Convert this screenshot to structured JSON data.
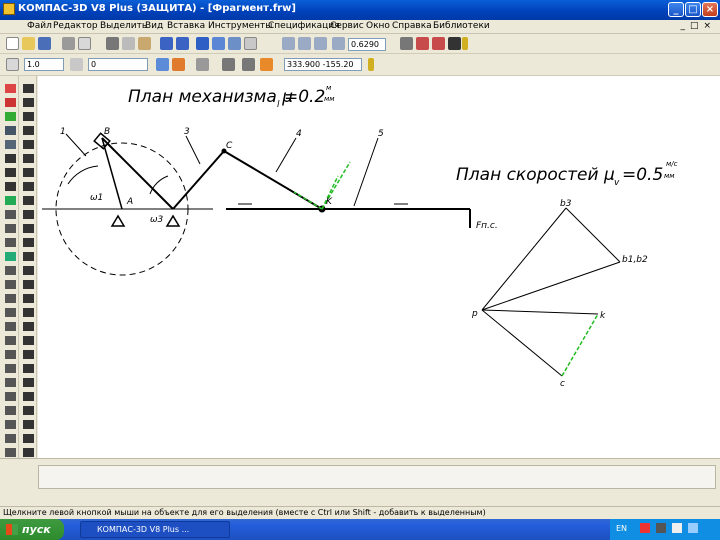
{
  "window": {
    "title": "КОМПАС-3D V8 Plus (ЗАЩИТА) - [Фрагмент.frw]"
  },
  "menu": {
    "items": [
      "Файл",
      "Редактор",
      "Выделить",
      "Вид",
      "Вставка",
      "Инструменты",
      "Спецификация",
      "Сервис",
      "Окно",
      "Справка",
      "Библиотеки"
    ]
  },
  "toolbar": {
    "scale_value": "0.6290",
    "style_value": "1.0",
    "layer_value": "0",
    "coords_value": "333.900   -155.20"
  },
  "drawing": {
    "mechanism_title": "План механизма  μ",
    "mechanism_sub": "l",
    "mechanism_val": "=0.2",
    "mechanism_unit_top": "м",
    "mechanism_unit_bottom": "мм",
    "velocity_title": "План скоростей  μ",
    "velocity_sub": "v",
    "velocity_val": "=0.5",
    "velocity_unit_top": "м/с",
    "velocity_unit_bottom": "мм",
    "mechanism_labels": {
      "link1": "1",
      "link3": "3",
      "link4": "4",
      "link5": "5",
      "pointB": "B",
      "pointC": "C",
      "pointA": "A",
      "pointK": "K",
      "w1": "ω1",
      "w3": "ω3",
      "force": "Fп.с."
    },
    "velocity_labels": {
      "pole": "p",
      "b3": "b3",
      "b1b2": "b1,b2",
      "k": "k",
      "c": "c"
    }
  },
  "status": {
    "hint": "Щелкните левой кнопкой мыши на объекте для его выделения (вместе с Ctrl или Shift - добавить к выделенным)"
  },
  "taskbar": {
    "start_label": "пуск",
    "app_item": "КОМПАС-3D V8 Plus ...",
    "lang": "EN"
  },
  "colors": {
    "titlebar": "#0a5fd8",
    "accent_green": "#22bb22",
    "drawing_line": "#000000"
  }
}
